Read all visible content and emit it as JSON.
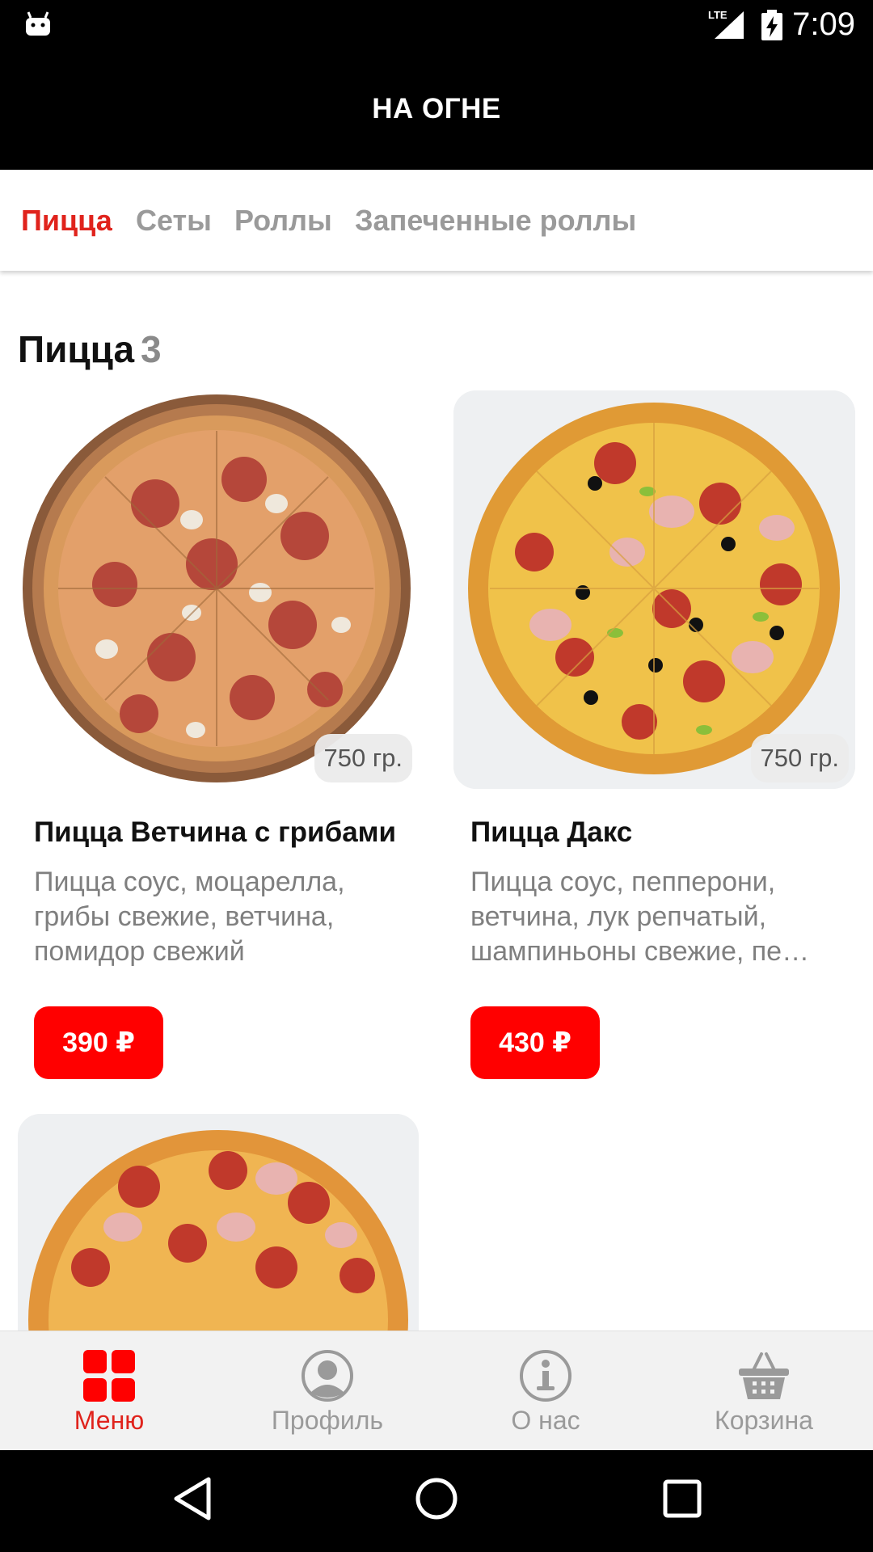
{
  "status_bar": {
    "time": "7:09",
    "network": "LTE"
  },
  "app_bar": {
    "title": "НА ОГНЕ"
  },
  "tabs": [
    {
      "label": "Пицца",
      "active": true
    },
    {
      "label": "Сеты",
      "active": false
    },
    {
      "label": "Роллы",
      "active": false
    },
    {
      "label": "Запеченные роллы",
      "active": false
    }
  ],
  "section": {
    "title": "Пицца",
    "count": "3"
  },
  "products": [
    {
      "name": "Пицца Ветчина с грибами",
      "description": "Пицца соус, моцарелла, грибы свежие, ветчина, помидор свежий",
      "weight": "750 гр.",
      "price": "390 ₽",
      "image": "pizza-ham-mushroom-photo"
    },
    {
      "name": "Пицца Дакс",
      "description": "Пицца соус, пепперони, ветчина, лук репчатый, шампиньоны свежие, пе…",
      "weight": "750 гр.",
      "price": "430 ₽",
      "image": "pizza-daks-photo"
    },
    {
      "image": "pizza-third-photo"
    }
  ],
  "bottom_nav": [
    {
      "label": "Меню",
      "icon": "grid-icon",
      "active": true
    },
    {
      "label": "Профиль",
      "icon": "profile-icon",
      "active": false
    },
    {
      "label": "О нас",
      "icon": "info-icon",
      "active": false
    },
    {
      "label": "Корзина",
      "icon": "basket-icon",
      "active": false
    }
  ],
  "colors": {
    "accent": "#ff0000",
    "accent_text": "#e0231c",
    "app_bar": "#000000"
  }
}
